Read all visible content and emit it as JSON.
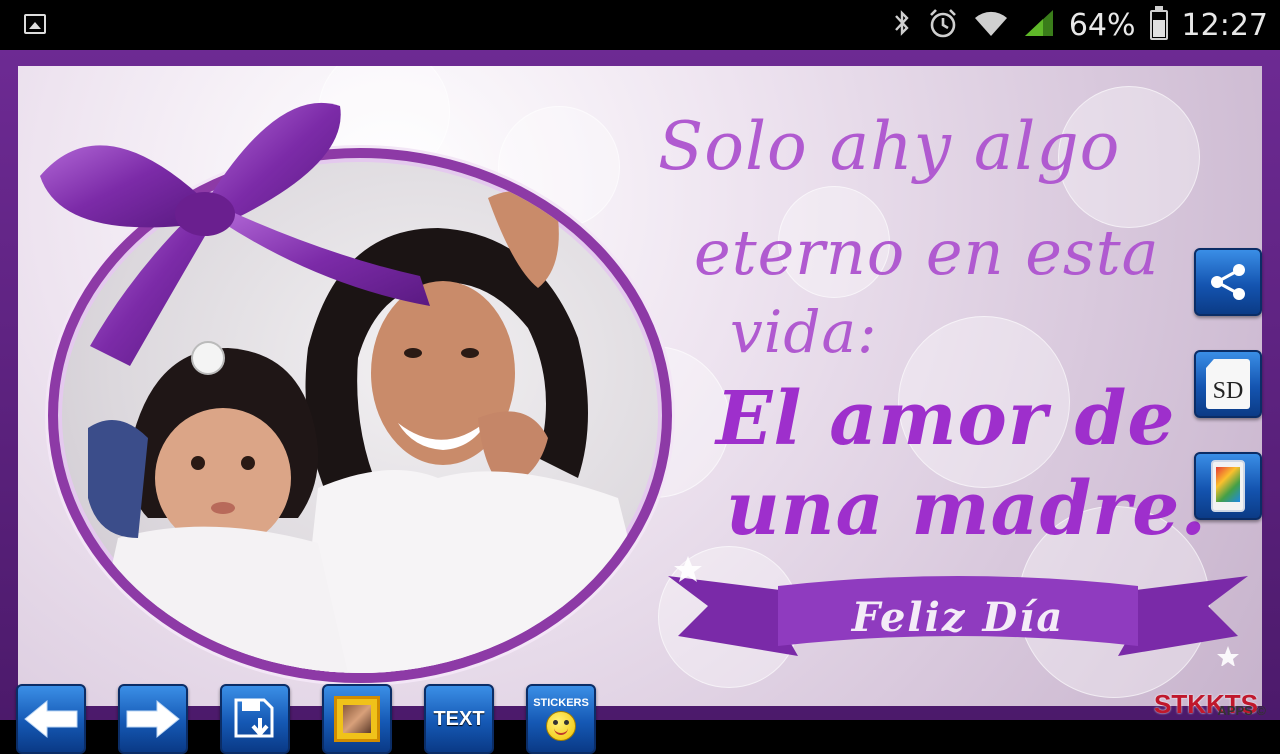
{
  "status_bar": {
    "battery_percent": "64%",
    "clock": "12:27",
    "icons": [
      "gallery-notification-icon",
      "bluetooth-icon",
      "alarm-icon",
      "wifi-icon",
      "signal-icon",
      "battery-icon"
    ],
    "battery_level": 0.64
  },
  "card": {
    "message_lines": [
      "Solo ahy algo",
      "eterno en esta",
      "vida:",
      "El amor de",
      "una madre."
    ],
    "banner_text": "Feliz Día",
    "accent_color": "#9e2fcc",
    "frame_color": "#8d3aa6"
  },
  "side_buttons": {
    "share_icon": "share-icon",
    "sd_label": "SD",
    "gallery_icon": "gallery-icon"
  },
  "toolbar": {
    "prev_icon": "arrow-left-icon",
    "next_icon": "arrow-right-icon",
    "save_icon": "save-icon",
    "frame_icon": "frame-icon",
    "text_label": "TEXT",
    "stickers_label": "STICKERS",
    "stickers_icon": "smiley-icon"
  },
  "brand": {
    "name": "STKKTS",
    "sub": "APPS ©"
  }
}
